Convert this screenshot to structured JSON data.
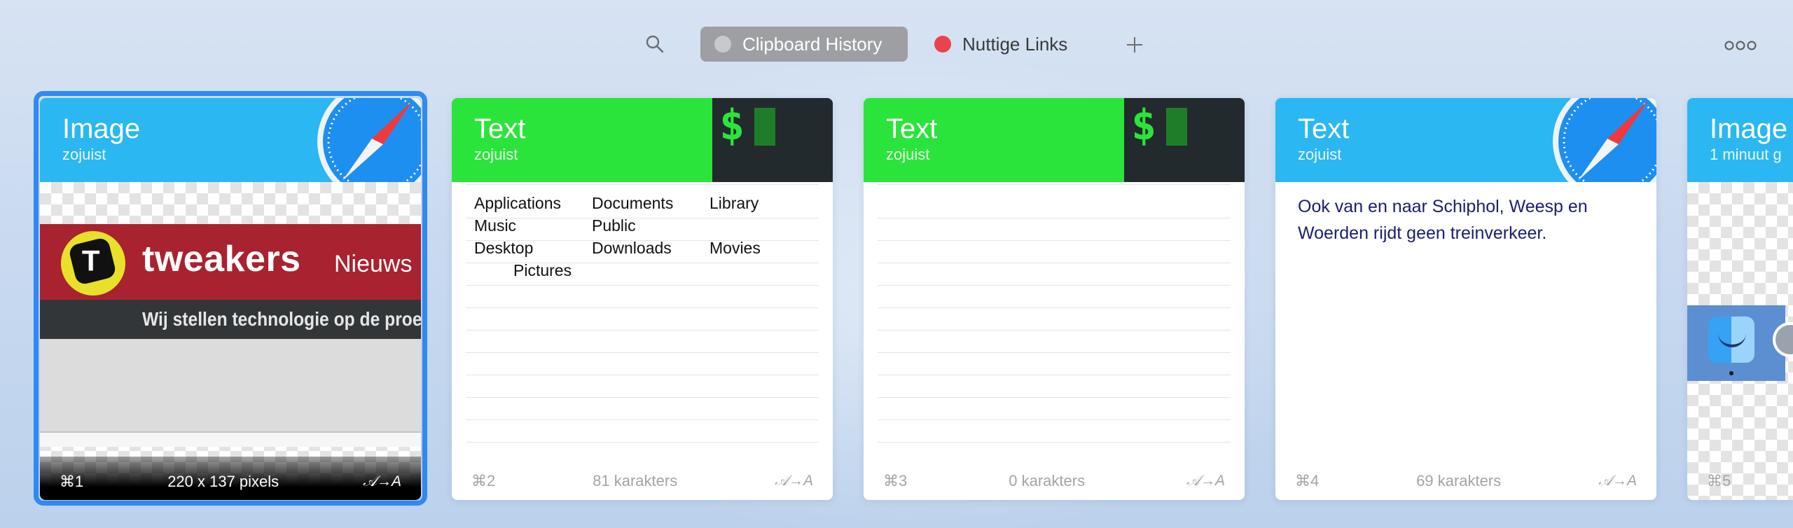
{
  "toolbar": {
    "search_icon": "search-icon",
    "tabs": [
      {
        "label": "Clipboard History",
        "dot_color": "#c8c9cc",
        "active": true
      },
      {
        "label": "Nuttige Links",
        "dot_color": "#e8434f",
        "active": false
      }
    ],
    "add_icon": "plus-icon",
    "more_icon": "more-icon"
  },
  "cards": [
    {
      "type": "Image",
      "time": "zojuist",
      "app_icon": "safari-icon",
      "header_color": "#2ab7f2",
      "preview": {
        "site_word": "tweakers",
        "section": "Nieuws",
        "slogan": "Wij stellen technologie op de proef"
      },
      "shortcut": "⌘1",
      "info": "220 x 137 pixels",
      "format_label": "𝒜→A",
      "selected": true
    },
    {
      "type": "Text",
      "time": "zojuist",
      "app_icon": "terminal-icon",
      "header_color": "#2be43b",
      "terminal_prompt": "$",
      "content_grid": [
        [
          "Applications",
          "Documents",
          "Library"
        ],
        [
          "Music",
          "Public",
          ""
        ],
        [
          "Desktop",
          "Downloads",
          "Movies"
        ],
        [
          "Pictures",
          "",
          ""
        ]
      ],
      "shortcut": "⌘2",
      "info": "81 karakters",
      "format_label": "𝒜→A"
    },
    {
      "type": "Text",
      "time": "zojuist",
      "app_icon": "terminal-icon",
      "header_color": "#2be43b",
      "terminal_prompt": "$",
      "shortcut": "⌘3",
      "info": "0 karakters",
      "format_label": "𝒜→A"
    },
    {
      "type": "Text",
      "time": "zojuist",
      "app_icon": "safari-icon",
      "header_color": "#2ab7f2",
      "content": "Ook van en naar Schiphol, Weesp en Woerden rijdt geen treinverkeer.",
      "shortcut": "⌘4",
      "info": "69 karakters",
      "format_label": "𝒜→A"
    },
    {
      "type": "Image",
      "time": "1 minuut g",
      "header_color": "#2ab7f2",
      "shortcut": "⌘5"
    }
  ]
}
